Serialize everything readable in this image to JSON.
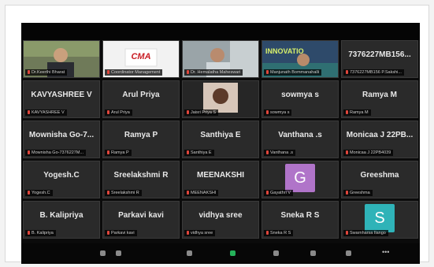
{
  "participants": [
    {
      "type": "video",
      "label": "Dr.Keerthi Bharat",
      "scene": "man-office"
    },
    {
      "type": "video",
      "label": "Coordinator Management",
      "scene": "logo-cma",
      "logo_text": "CMA"
    },
    {
      "type": "video",
      "label": "Dr. Hemalatha Maheswari",
      "scene": "woman"
    },
    {
      "type": "video",
      "label": "Manjunath Bommanahalli",
      "scene": "innovation",
      "overlay_text": "INNOVATIO"
    },
    {
      "type": "text",
      "big": "7376227MB156...",
      "label": "7376227MB156 P.Sakshi..."
    },
    {
      "type": "text",
      "big": "KAVYASHREE V",
      "label": "KAVYASHREE V"
    },
    {
      "type": "text",
      "big": "Arul Priya",
      "label": "Arul Priya"
    },
    {
      "type": "video",
      "label": "Jaisri Priya S",
      "scene": "photo"
    },
    {
      "type": "text",
      "big": "sowmya s",
      "label": "sowmya s"
    },
    {
      "type": "text",
      "big": "Ramya M",
      "label": "Ramya M"
    },
    {
      "type": "text",
      "big": "Mownisha Go-7...",
      "label": "Mownisha Go-7376227M..."
    },
    {
      "type": "text",
      "big": "Ramya P",
      "label": "Ramya P"
    },
    {
      "type": "text",
      "big": "Santhiya E",
      "label": "Santhiya E"
    },
    {
      "type": "text",
      "big": "Vanthana .s",
      "label": "Vanthana .s"
    },
    {
      "type": "text",
      "big": "Monicaa J 22PB...",
      "label": "Monicaa J 22PB4039"
    },
    {
      "type": "text",
      "big": "Yogesh.C",
      "label": "Yogesh.C"
    },
    {
      "type": "text",
      "big": "Sreelakshmi R",
      "label": "Sreelakshmi R"
    },
    {
      "type": "text",
      "big": "MEENAKSHI",
      "label": "MEENAKSHI"
    },
    {
      "type": "avatar",
      "letter": "G",
      "color": "#b074c9",
      "label": "Gayathri V"
    },
    {
      "type": "text",
      "big": "Greeshma",
      "label": "Greeshma"
    },
    {
      "type": "text",
      "big": "B. Kalipriya",
      "label": "B. Kalipriya"
    },
    {
      "type": "text",
      "big": "Parkavi kavi",
      "label": "Parkavi kavi"
    },
    {
      "type": "text",
      "big": "vidhya sree",
      "label": "vidhya sree"
    },
    {
      "type": "text",
      "big": "Sneka R S",
      "label": "Sneka R S"
    },
    {
      "type": "avatar",
      "letter": "S",
      "color": "#2fb3b8",
      "label": "Swarnharsa Ilango"
    }
  ]
}
